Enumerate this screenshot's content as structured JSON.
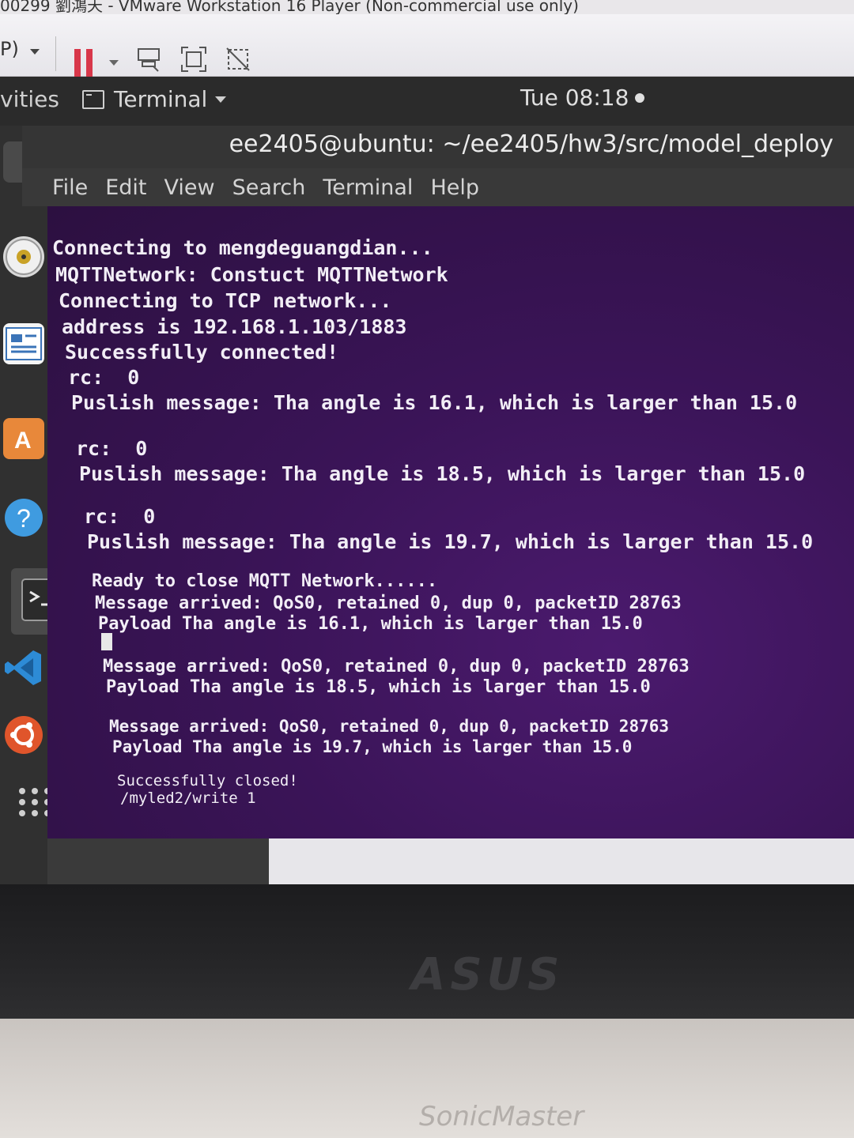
{
  "vm_window": {
    "title": "00299 劉鴻天 - VMware Workstation 16 Player (Non-commercial use only)",
    "toolbar_label": "P)"
  },
  "ubuntu_topbar": {
    "activities": "vities",
    "app_menu": "Terminal",
    "clock": "Tue 08:18"
  },
  "terminal": {
    "title": "ee2405@ubuntu: ~/ee2405/hw3/src/model_deploy",
    "menu": [
      "File",
      "Edit",
      "View",
      "Search",
      "Terminal",
      "Help"
    ],
    "lines": [
      "Connecting to mengdeguangdian...",
      "MQTTNetwork: Constuct MQTTNetwork",
      "Connecting to TCP network...",
      "address is 192.168.1.103/1883",
      "Successfully connected!",
      "rc:  0",
      "Puslish message: Tha angle is 16.1, which is larger than 15.0",
      "rc:  0",
      "Puslish message: Tha angle is 18.5, which is larger than 15.0",
      "rc:  0",
      "Puslish message: Tha angle is 19.7, which is larger than 15.0",
      "Ready to close MQTT Network......",
      "Message arrived: QoS0, retained 0, dup 0, packetID 28763",
      "Payload Tha angle is 16.1, which is larger than 15.0",
      "Message arrived: QoS0, retained 0, dup 0, packetID 28763",
      "Payload Tha angle is 18.5, which is larger than 15.0",
      "Message arrived: QoS0, retained 0, dup 0, packetID 28763",
      "Payload Tha angle is 19.7, which is larger than 15.0",
      "Successfully closed!",
      "/myled2/write 1"
    ]
  },
  "laptop": {
    "bezel_logo": "ASUS",
    "deck_brand": "SonicMaster"
  },
  "colors": {
    "terminal_bg": "#3a1457",
    "terminal_text": "#f2eef6",
    "pause_red": "#d8374a",
    "vscode_blue": "#2d8bd6",
    "ubuntu_orange": "#e0552b"
  }
}
